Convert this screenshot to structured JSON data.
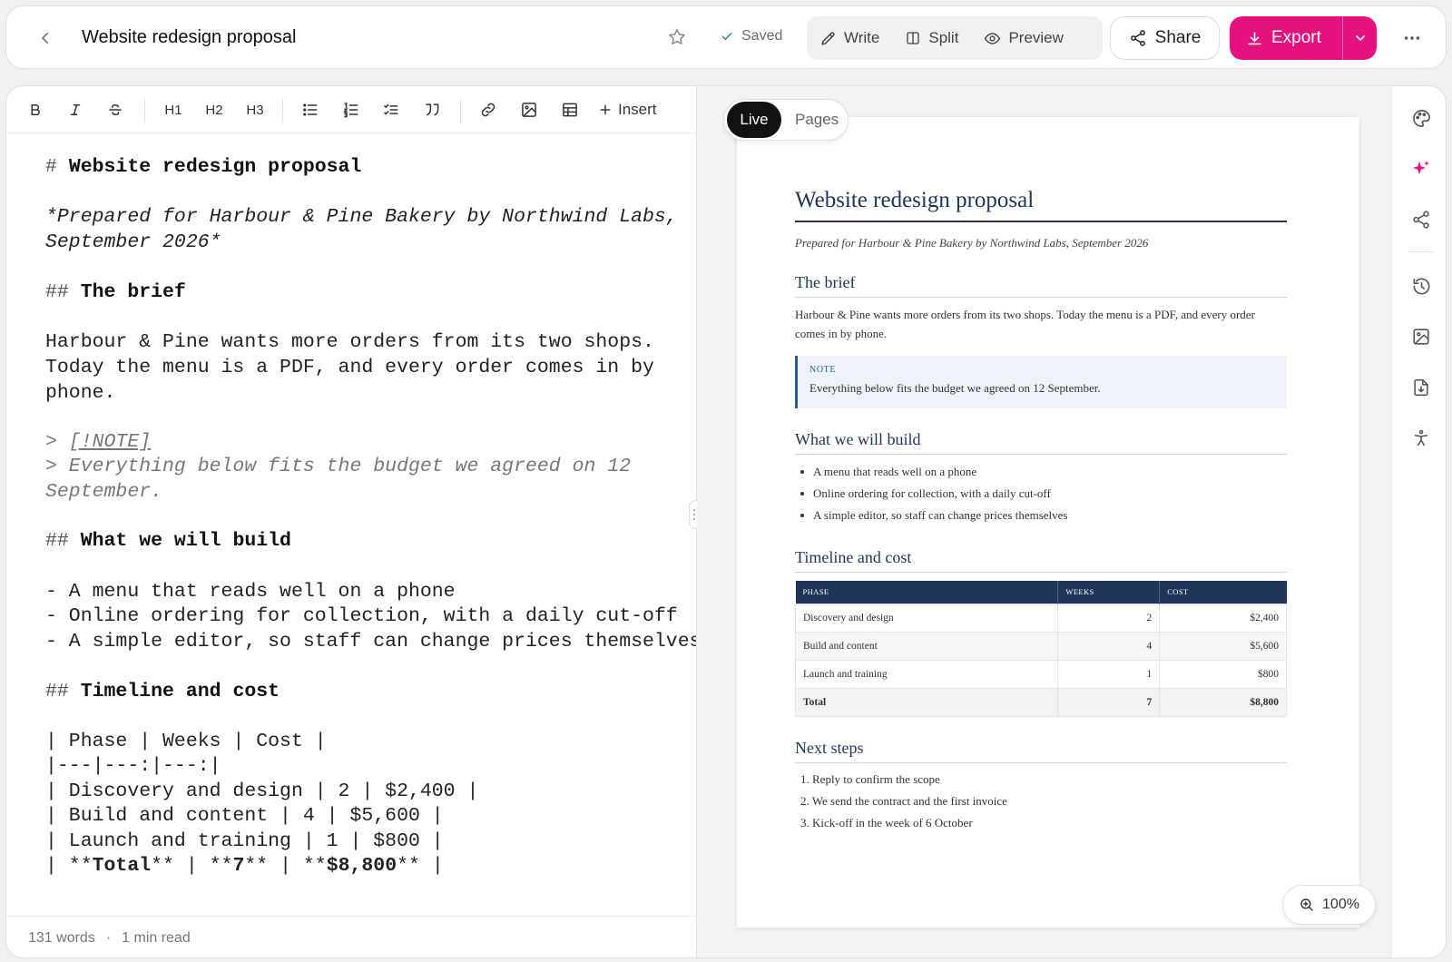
{
  "header": {
    "title": "Website redesign proposal",
    "saved_label": "Saved",
    "modes": {
      "write": "Write",
      "split": "Split",
      "preview": "Preview"
    },
    "share_label": "Share",
    "export_label": "Export"
  },
  "toolbar": {
    "h1": "H1",
    "h2": "H2",
    "h3": "H3",
    "insert_label": "Insert"
  },
  "source": {
    "l1_marker": "# ",
    "l1_text": "Website redesign proposal",
    "l2": "*Prepared for Harbour & Pine Bakery by Northwind Labs,",
    "l3": "September 2026*",
    "l4_marker": "## ",
    "l4_text": "The brief",
    "l5": "Harbour & Pine wants more orders from its two shops.",
    "l6": "Today the menu is a PDF, and every order comes in by",
    "l7": "phone.",
    "l8_marker": "> ",
    "l8_text": "[!NOTE]",
    "l9": "> Everything below fits the budget we agreed on 12",
    "l10": "September.",
    "l11_marker": "## ",
    "l11_text": "What we will build",
    "l12": "- A menu that reads well on a phone",
    "l13": "- Online ordering for collection, with a daily cut-off",
    "l14": "- A simple editor, so staff can change prices themselves",
    "l15_marker": "## ",
    "l15_text": "Timeline and cost",
    "l16": "| Phase | Weeks | Cost |",
    "l17": "|---|---:|---:|",
    "l18": "| Discovery and design | 2 | $2,400 |",
    "l19": "| Build and content | 4 | $5,600 |",
    "l20": "| Launch and training | 1 | $800 |",
    "l21_a": "| **",
    "l21_b": "Total",
    "l21_c": "** | **",
    "l21_d": "7",
    "l21_e": "** | **",
    "l21_f": "$8,800",
    "l21_g": "** |"
  },
  "status": {
    "words": "131 words",
    "dot": "·",
    "read_time": "1 min read"
  },
  "preview_toggle": {
    "live": "Live",
    "pages": "Pages"
  },
  "preview": {
    "title": "Website redesign proposal",
    "subtitle": "Prepared for Harbour & Pine Bakery by Northwind Labs, September 2026",
    "brief_heading": "The brief",
    "brief_text": "Harbour & Pine wants more orders from its two shops. Today the menu is a PDF, and every order comes in by phone.",
    "note_label": "NOTE",
    "note_text": "Everything below fits the budget we agreed on 12 September.",
    "build_heading": "What we will build",
    "build_items": [
      "A menu that reads well on a phone",
      "Online ordering for collection, with a daily cut-off",
      "A simple editor, so staff can change prices themselves"
    ],
    "timeline_heading": "Timeline and cost",
    "table_headers": [
      "PHASE",
      "WEEKS",
      "COST"
    ],
    "table_rows": [
      [
        "Discovery and design",
        "2",
        "$2,400"
      ],
      [
        "Build and content",
        "4",
        "$5,600"
      ],
      [
        "Launch and training",
        "1",
        "$800"
      ]
    ],
    "table_total": [
      "Total",
      "7",
      "$8,800"
    ],
    "next_heading": "Next steps",
    "next_items": [
      "1. Reply to confirm the scope",
      "2. We send the contract and the first invoice",
      "3. Kick-off in the week of 6 October"
    ]
  },
  "zoom_label": "100%",
  "colors": {
    "accent": "#e4117f",
    "heading_navy": "#1e3557",
    "note_blue": "#2a5a9e"
  },
  "icons": {
    "header": [
      "back-chevron-icon",
      "star-icon",
      "check-icon",
      "pencil-icon",
      "split-icon",
      "eye-icon",
      "share-icon",
      "download-icon",
      "chevron-down-icon",
      "more-icon"
    ],
    "toolbar": [
      "bold-icon",
      "italic-icon",
      "strikethrough-icon",
      "bullet-list-icon",
      "numbered-list-icon",
      "checklist-icon",
      "quote-icon",
      "link-icon",
      "image-icon",
      "table-icon",
      "plus-icon"
    ],
    "rail": [
      "palette-icon",
      "sparkle-icon",
      "share-icon",
      "history-icon",
      "image-icon",
      "file-download-icon",
      "accessibility-icon"
    ],
    "zoom": "zoom-in-icon"
  }
}
